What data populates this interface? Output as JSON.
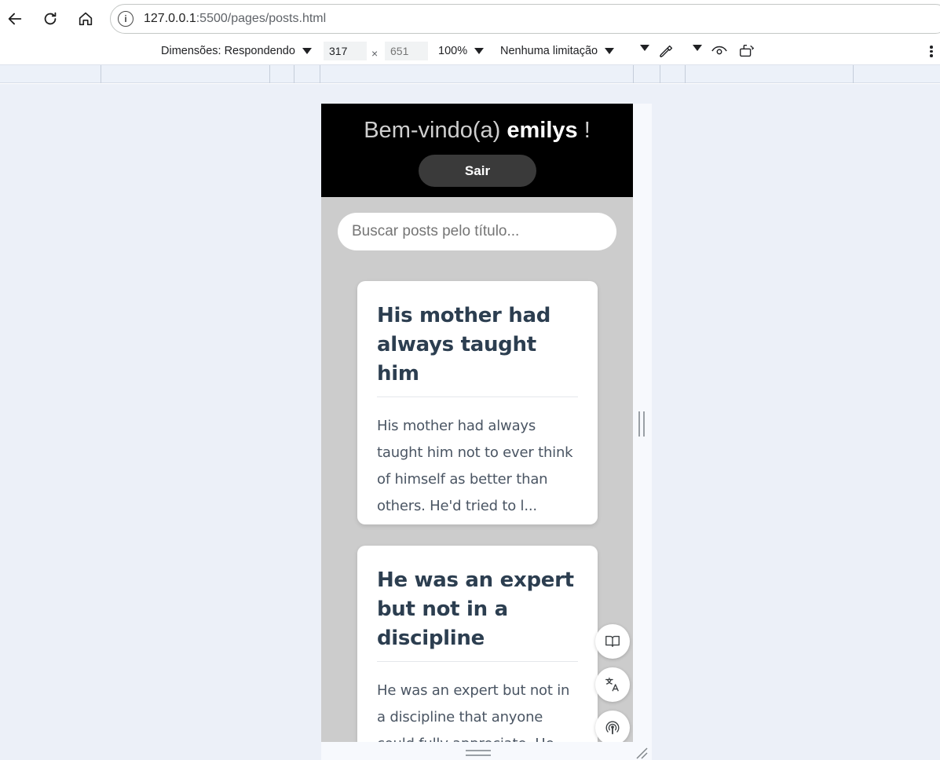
{
  "browser": {
    "url_host": "127.0.0.1",
    "url_path": ":5500/pages/posts.html"
  },
  "devtools": {
    "dimensions_label": "Dimensões: Respondendo",
    "width_value": "317",
    "height_placeholder": "651",
    "times_symbol": "×",
    "zoom": "100%",
    "throttling": "Nenhuma limitação"
  },
  "page": {
    "welcome_prefix": "Bem-vindo(a)",
    "username": "emilys",
    "welcome_suffix": "!",
    "logout_label": "Sair",
    "search_placeholder": "Buscar posts pelo título...",
    "posts": [
      {
        "title": "His mother had always taught him",
        "excerpt": "His mother had always taught him not to ever think of himself as better than others. He'd tried to l..."
      },
      {
        "title": "He was an expert but not in a discipline",
        "excerpt": "He was an expert but not in a discipline that anyone could fully appreciate. He"
      }
    ]
  },
  "floating_buttons": [
    "book-icon",
    "translate-icon",
    "podcast-icon"
  ],
  "colors": {
    "header_bg": "#000000",
    "page_bg": "#cccccc",
    "card_title": "#2c3e50",
    "card_text": "#4a5563",
    "logout_bg": "#3a3a3a"
  }
}
